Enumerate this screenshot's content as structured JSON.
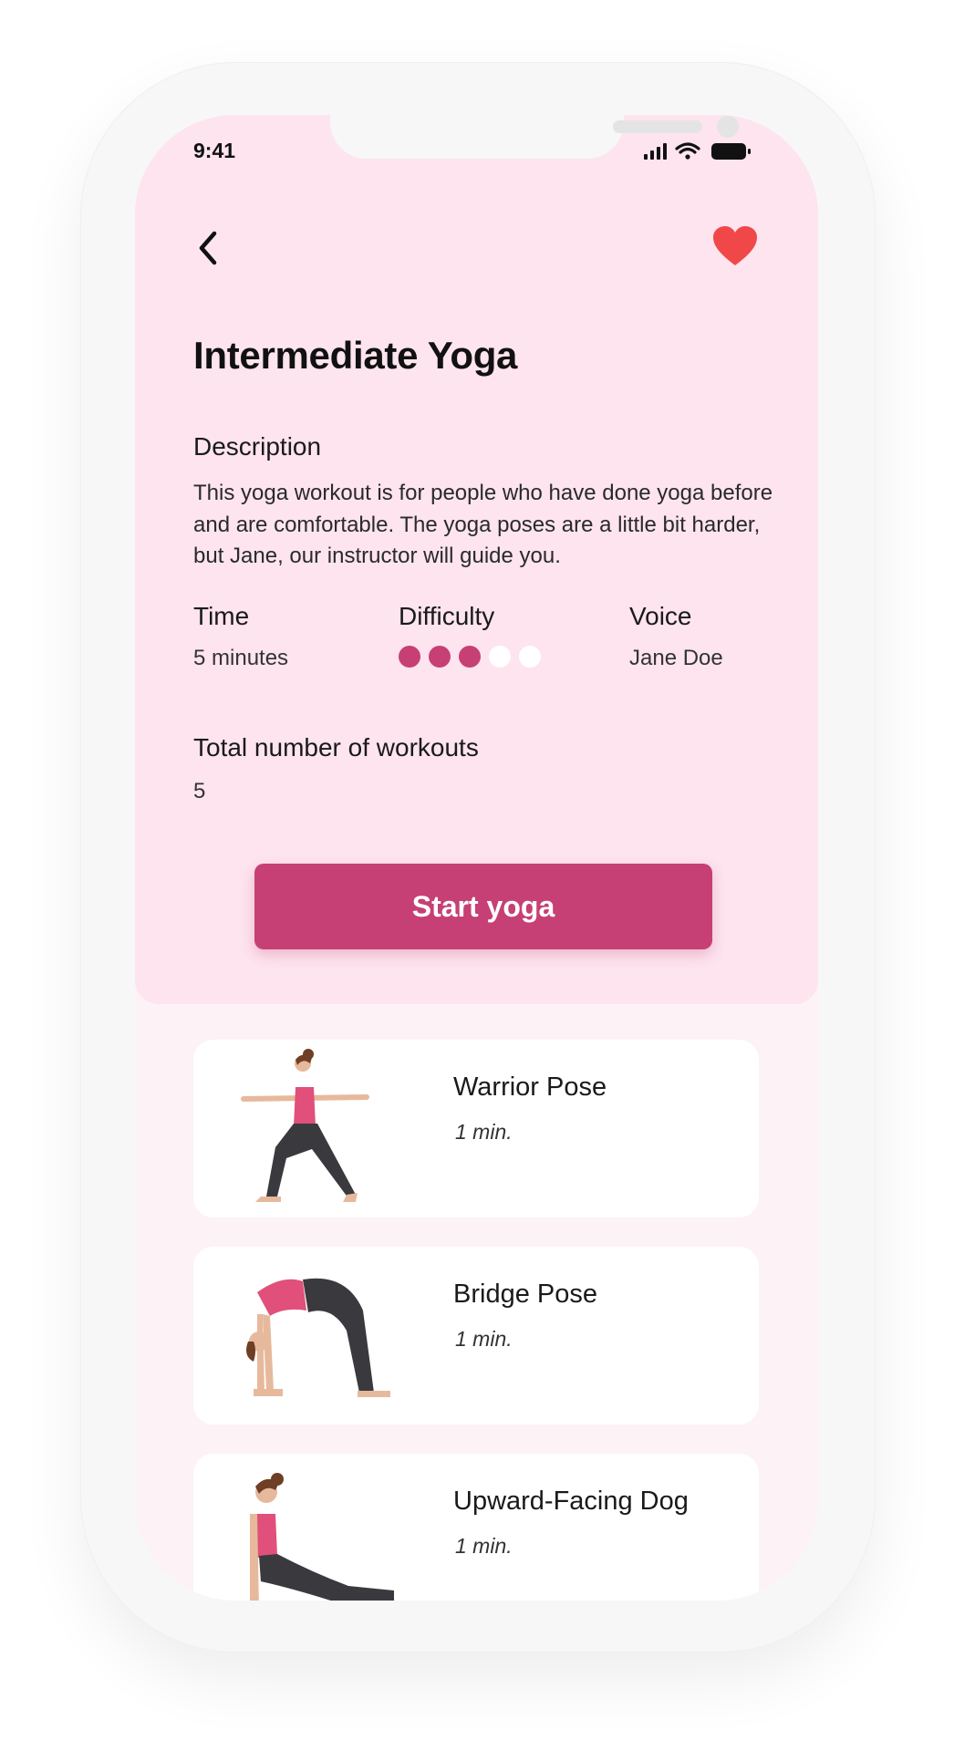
{
  "status": {
    "time": "9:41"
  },
  "header": {
    "back_icon": "chevron-left-icon",
    "favorite_icon": "heart-icon",
    "favorite_color": "#f04848"
  },
  "workout": {
    "title": "Intermediate Yoga",
    "description_label": "Description",
    "description": "This yoga workout is for people who have done yoga before and are comfortable. The yoga poses are a little bit harder, but Jane, our instructor will guide you.",
    "time_label": "Time",
    "time_value": "5 minutes",
    "difficulty_label": "Difficulty",
    "difficulty_level": 3,
    "difficulty_max": 5,
    "voice_label": "Voice",
    "voice_value": "Jane Doe",
    "total_label": "Total number of workouts",
    "total_value": "5"
  },
  "actions": {
    "start_label": "Start yoga"
  },
  "poses": [
    {
      "name": "Warrior Pose",
      "duration": "1 min."
    },
    {
      "name": "Bridge Pose",
      "duration": "1 min."
    },
    {
      "name": "Upward-Facing Dog",
      "duration": "1 min."
    }
  ],
  "colors": {
    "accent": "#c64075",
    "panel": "#fde4ee",
    "background": "#fdf2f6"
  }
}
